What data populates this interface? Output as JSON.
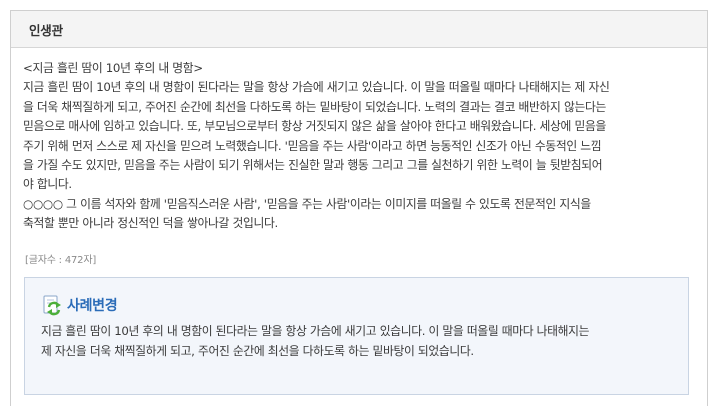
{
  "panel": {
    "title": "인생관"
  },
  "essay": {
    "lines": [
      "<지금 흘린 땀이 10년 후의 내 명함>",
      "지금 흘린 땀이 10년 후의 내 명함이 된다라는 말을 항상 가슴에 새기고 있습니다. 이 말을 떠올릴 때마다 나태해지는 제 자신",
      "을 더욱 채찍질하게 되고, 주어진 순간에 최선을 다하도록 하는 밑바탕이 되었습니다. 노력의 결과는 결코 배반하지 않는다는",
      "믿음으로 매사에 임하고 있습니다. 또, 부모님으로부터 항상 거짓되지 않은 삶을 살아야 한다고 배워왔습니다. 세상에 믿음을",
      "주기 위해 먼저 스스로 제 자신을 믿으려 노력했습니다. '믿음을 주는 사람'이라고 하면 능동적인 신조가 아닌 수동적인 느낌",
      "을 가질 수도 있지만, 믿음을 주는 사람이 되기 위해서는 진실한 말과 행동 그리고 그를 실천하기 위한 노력이 늘 뒷받침되어",
      "야 합니다.",
      "○○○○ 그 이름 석자와 함께 '믿음직스러운 사람', '믿음을 주는 사람'이라는 이미지를 떠올릴 수 있도록 전문적인 지식을",
      "축적할 뿐만 아니라 정신적인 덕을 쌓아나갈 것입니다."
    ],
    "char_count": "[글자수 : 472자]"
  },
  "example": {
    "title": "사례변경",
    "icon": "refresh-document-icon",
    "lines": [
      "지금 흘린 땀이 10년 후의 내 명함이 된다라는 말을 항상 가슴에 새기고 있습니다. 이 말을 떠올릴 때마다 나태해지는",
      "제 자신을 더욱 채찍질하게 되고, 주어진 순간에 최선을 다하도록 하는 밑바탕이 되었습니다."
    ]
  },
  "colors": {
    "header_bg": "#f4f4f4",
    "border": "#cfcfcf",
    "example_bg": "#f3f6fb",
    "example_border": "#c9d4e3",
    "example_title": "#2b6cb8",
    "icon_green": "#4caf3a"
  }
}
